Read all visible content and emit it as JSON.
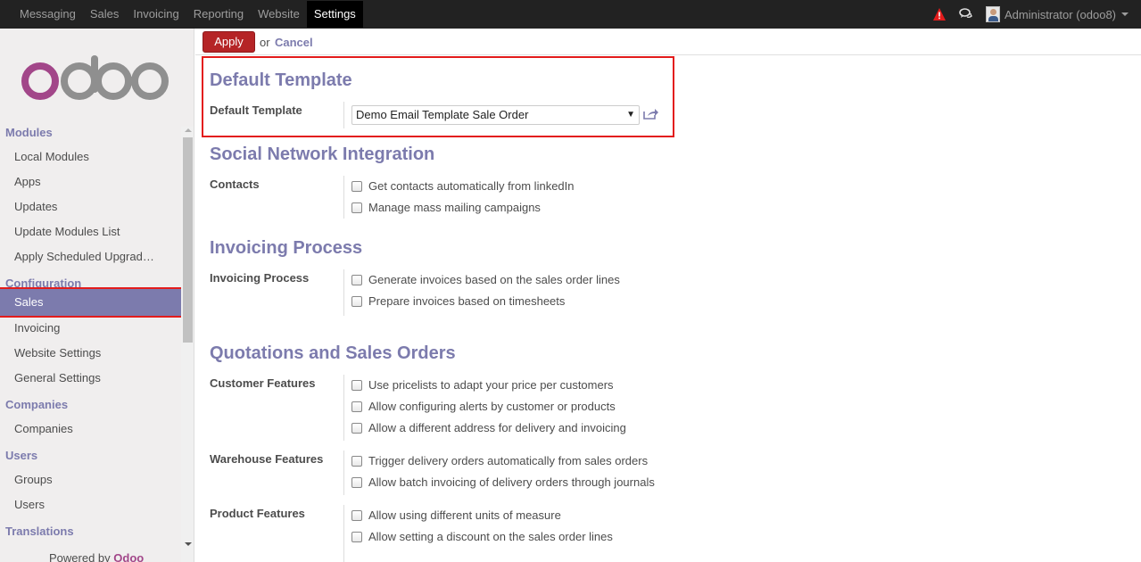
{
  "topbar": {
    "menu": [
      "Messaging",
      "Sales",
      "Invoicing",
      "Reporting",
      "Website",
      "Settings"
    ],
    "active": "Settings",
    "user": "Administrator (odoo8)"
  },
  "sidebar": {
    "sections": [
      {
        "title": "Modules",
        "items": [
          "Local Modules",
          "Apps",
          "Updates",
          "Update Modules List",
          "Apply Scheduled Upgrad…"
        ]
      },
      {
        "title": "Configuration",
        "items": [
          "Sales",
          "Invoicing",
          "Website Settings",
          "General Settings"
        ]
      },
      {
        "title": "Companies",
        "items": [
          "Companies"
        ]
      },
      {
        "title": "Users",
        "items": [
          "Groups",
          "Users"
        ]
      },
      {
        "title": "Translations",
        "items": []
      }
    ],
    "selected": "Sales",
    "powered_by": "Powered by",
    "brand": "Odoo"
  },
  "actions": {
    "apply": "Apply",
    "or": "or",
    "cancel": "Cancel"
  },
  "default_template": {
    "heading": "Default Template",
    "label": "Default Template",
    "value": "Demo Email Template Sale Order"
  },
  "social": {
    "heading": "Social Network Integration",
    "label": "Contacts",
    "options": [
      "Get contacts automatically from linkedIn",
      "Manage mass mailing campaigns"
    ]
  },
  "invoicing": {
    "heading": "Invoicing Process",
    "label": "Invoicing Process",
    "options": [
      "Generate invoices based on the sales order lines",
      "Prepare invoices based on timesheets"
    ]
  },
  "quotations": {
    "heading": "Quotations and Sales Orders",
    "customer_label": "Customer Features",
    "customer_options": [
      "Use pricelists to adapt your price per customers",
      "Allow configuring alerts by customer or products",
      "Allow a different address for delivery and invoicing"
    ],
    "warehouse_label": "Warehouse Features",
    "warehouse_options": [
      "Trigger delivery orders automatically from sales orders",
      "Allow batch invoicing of delivery orders through journals"
    ],
    "product_label": "Product Features",
    "product_options": [
      "Allow using different units of measure",
      "Allow setting a discount on the sales order lines"
    ]
  },
  "colors": {
    "accent": "#7c7bad",
    "apply": "#b52426",
    "highlight": "#e31c1c",
    "topbar": "#222222"
  }
}
